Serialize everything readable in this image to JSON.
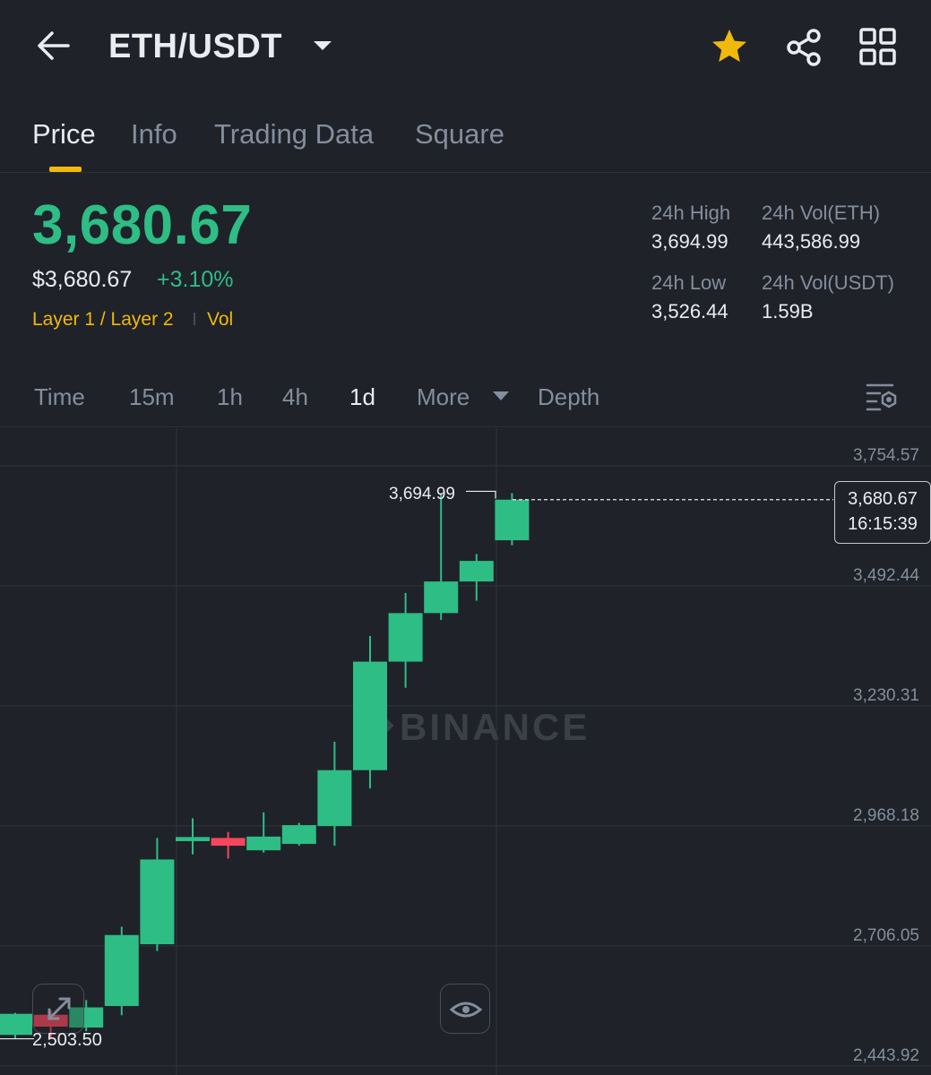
{
  "header": {
    "pair": "ETH/USDT",
    "icons": [
      "arrow-left-icon",
      "caret-down-icon",
      "star-icon",
      "share-icon",
      "grid-icon"
    ],
    "star_color": "#f0b90b"
  },
  "tabs": [
    {
      "label": "Price",
      "active": true
    },
    {
      "label": "Info",
      "active": false
    },
    {
      "label": "Trading Data",
      "active": false
    },
    {
      "label": "Square",
      "active": false
    }
  ],
  "ticker": {
    "last_price": "3,680.67",
    "usd_price": "$3,680.67",
    "change_pct": "+3.10%",
    "tag_category": "Layer 1 / Layer 2",
    "tag_vol": "Vol",
    "high_label": "24h High",
    "high_value": "3,694.99",
    "vol_eth_label": "24h Vol(ETH)",
    "vol_eth_value": "443,586.99",
    "low_label": "24h Low",
    "low_value": "3,526.44",
    "vol_usdt_label": "24h Vol(USDT)",
    "vol_usdt_value": "1.59B",
    "up_color": "#2ebd85",
    "down_color": "#f6465d"
  },
  "intervals": [
    {
      "label": "Time",
      "active": false
    },
    {
      "label": "15m",
      "active": false
    },
    {
      "label": "1h",
      "active": false
    },
    {
      "label": "4h",
      "active": false
    },
    {
      "label": "1d",
      "active": true
    },
    {
      "label": "More",
      "active": false
    },
    {
      "label": "Depth",
      "active": false
    }
  ],
  "chart": {
    "y_axis_labels": [
      "3,754.57",
      "3,492.44",
      "3,230.31",
      "2,968.18",
      "2,706.05",
      "2,443.92"
    ],
    "high_marker": "3,694.99",
    "low_marker": "2,503.50",
    "current_price": "3,680.67",
    "countdown": "16:15:39",
    "watermark": "BINANCE"
  },
  "chart_data": {
    "type": "candlestick",
    "interval": "1d",
    "ylim": [
      2443.92,
      3754.57
    ],
    "y_ticks": [
      3754.57,
      3492.44,
      3230.31,
      2968.18,
      2706.05,
      2443.92
    ],
    "candles": [
      {
        "open": 2512,
        "close": 2558,
        "high": 2560,
        "low": 2503.5
      },
      {
        "open": 2556,
        "close": 2530,
        "high": 2565,
        "low": 2505
      },
      {
        "open": 2528,
        "close": 2572,
        "high": 2588,
        "low": 2520
      },
      {
        "open": 2575,
        "close": 2730,
        "high": 2748,
        "low": 2555
      },
      {
        "open": 2710,
        "close": 2895,
        "high": 2942,
        "low": 2695
      },
      {
        "open": 2935,
        "close": 2944,
        "high": 2985,
        "low": 2906
      },
      {
        "open": 2942,
        "close": 2925,
        "high": 2955,
        "low": 2897
      },
      {
        "open": 2915,
        "close": 2945,
        "high": 2998,
        "low": 2910
      },
      {
        "open": 2929,
        "close": 2970,
        "high": 2975,
        "low": 2925
      },
      {
        "open": 2968,
        "close": 3090,
        "high": 3152,
        "low": 2925
      },
      {
        "open": 3090,
        "close": 3327,
        "high": 3383,
        "low": 3050
      },
      {
        "open": 3327,
        "close": 3433,
        "high": 3477,
        "low": 3270
      },
      {
        "open": 3433,
        "close": 3502,
        "high": 3694.99,
        "low": 3418
      },
      {
        "open": 3502,
        "close": 3547,
        "high": 3562,
        "low": 3460
      },
      {
        "open": 3592,
        "close": 3680.67,
        "high": 3694.99,
        "low": 3581
      }
    ]
  }
}
